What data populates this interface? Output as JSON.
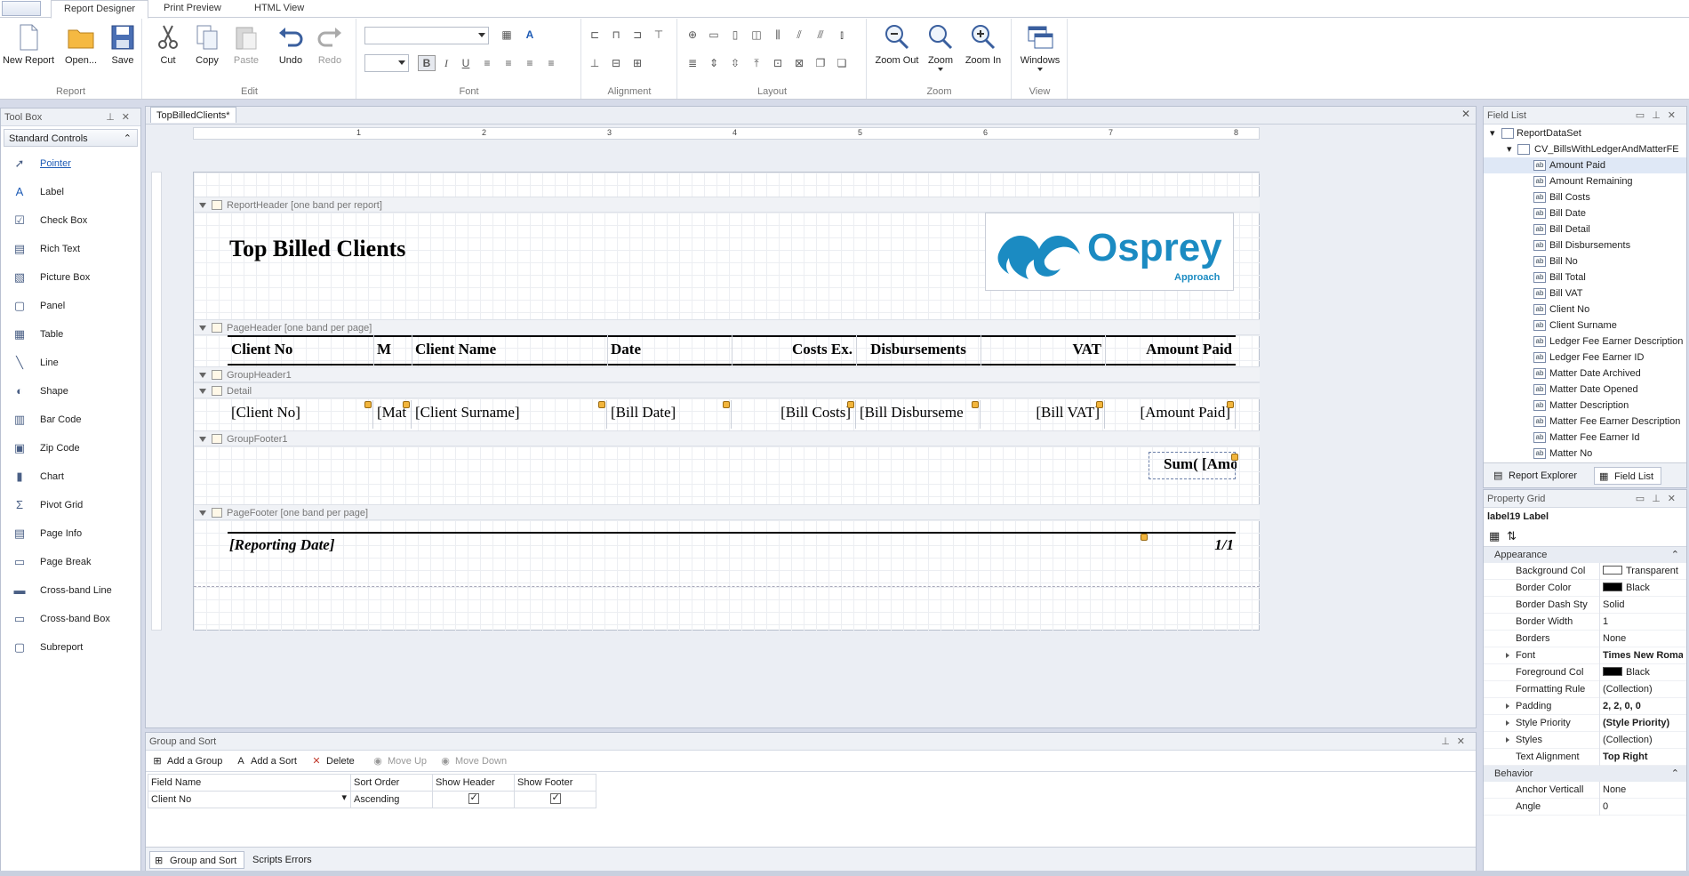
{
  "tabs": [
    "Report Designer",
    "Print Preview",
    "HTML View"
  ],
  "ribbon": {
    "report": {
      "label": "Report",
      "new": "New Report",
      "open": "Open...",
      "save": "Save"
    },
    "edit": {
      "label": "Edit",
      "cut": "Cut",
      "copy": "Copy",
      "paste": "Paste",
      "undo": "Undo",
      "redo": "Redo"
    },
    "font": {
      "label": "Font"
    },
    "alignment": {
      "label": "Alignment"
    },
    "layout": {
      "label": "Layout"
    },
    "zoom": {
      "label": "Zoom",
      "zoom_out": "Zoom Out",
      "zoom": "Zoom",
      "zoom_in": "Zoom In"
    },
    "view": {
      "label": "View",
      "windows": "Windows"
    }
  },
  "toolbox": {
    "title": "Tool Box",
    "category": "Standard Controls",
    "items": [
      "Pointer",
      "Label",
      "Check Box",
      "Rich Text",
      "Picture Box",
      "Panel",
      "Table",
      "Line",
      "Shape",
      "Bar Code",
      "Zip Code",
      "Chart",
      "Pivot Grid",
      "Page Info",
      "Page Break",
      "Cross-band Line",
      "Cross-band Box",
      "Subreport"
    ],
    "icons": [
      "pointer-icon",
      "label-icon",
      "checkbox-icon",
      "richtext-icon",
      "picturebox-icon",
      "panel-icon",
      "table-icon",
      "line-icon",
      "shape-icon",
      "barcode-icon",
      "zipcode-icon",
      "chart-icon",
      "pivotgrid-icon",
      "pageinfo-icon",
      "pagebreak-icon",
      "crossband-line-icon",
      "crossband-box-icon",
      "subreport-icon"
    ]
  },
  "document": {
    "tab": "TopBilledClients*",
    "ruler_marks": [
      "1",
      "2",
      "3",
      "4",
      "5",
      "6",
      "7",
      "8"
    ],
    "bands": {
      "report_header": "ReportHeader [one band per report]",
      "page_header": "PageHeader [one band per page]",
      "group_header": "GroupHeader1",
      "detail": "Detail",
      "group_footer": "GroupFooter1",
      "page_footer": "PageFooter [one band per page]"
    },
    "title": "Top Billed Clients",
    "logo": {
      "word": "Osprey",
      "tagline": "Approach",
      "color": "#1b8bc2"
    },
    "headers": [
      "Client No",
      "M",
      "Client Name",
      "Date",
      "Costs Ex.",
      "Disbursements",
      "VAT",
      "Amount Paid"
    ],
    "detail": [
      "[Client No]",
      "[Mat",
      "[Client Surname]",
      "[Bill Date]",
      "[Bill Costs]",
      "[Bill Disburseme",
      "[Bill VAT]",
      "[Amount Paid]"
    ],
    "group_footer_sum": "Sum( [Amount",
    "page_footer": {
      "date": "[Reporting Date]",
      "page": "1/1"
    }
  },
  "field_list": {
    "title": "Field List",
    "root": "ReportDataSet",
    "table": "CV_BillsWithLedgerAndMatterFE",
    "fields": [
      "Amount Paid",
      "Amount Remaining",
      "Bill Costs",
      "Bill Date",
      "Bill Detail",
      "Bill Disbursements",
      "Bill No",
      "Bill Total",
      "Bill VAT",
      "Client No",
      "Client Surname",
      "Ledger Fee Earner Description",
      "Ledger Fee Earner ID",
      "Matter Date Archived",
      "Matter Date Opened",
      "Matter Description",
      "Matter Fee Earner Description",
      "Matter Fee Earner Id",
      "Matter No"
    ],
    "tabs": [
      "Report Explorer",
      "Field List"
    ]
  },
  "property_grid": {
    "title": "Property Grid",
    "selected": "label19  Label",
    "categories": [
      "Appearance",
      "Behavior"
    ],
    "rows": [
      {
        "name": "Background Col",
        "value": "Transparent",
        "swatch": "#ffffff"
      },
      {
        "name": "Border Color",
        "value": "Black",
        "swatch": "#000000"
      },
      {
        "name": "Border Dash Sty",
        "value": "Solid"
      },
      {
        "name": "Border Width",
        "value": "1"
      },
      {
        "name": "Borders",
        "value": "None"
      },
      {
        "name": "Font",
        "value": "Times New Roma...",
        "bold": true,
        "expand": true
      },
      {
        "name": "Foreground Col",
        "value": "Black",
        "swatch": "#000000"
      },
      {
        "name": "Formatting Rule",
        "value": "(Collection)"
      },
      {
        "name": "Padding",
        "value": "2, 2, 0, 0",
        "bold": true,
        "expand": true
      },
      {
        "name": "Style Priority",
        "value": "(Style Priority)",
        "bold": true,
        "expand": true
      },
      {
        "name": "Styles",
        "value": "(Collection)",
        "expand": true
      },
      {
        "name": "Text Alignment",
        "value": "Top Right",
        "bold": true
      }
    ],
    "behavior_rows": [
      {
        "name": "Anchor Verticall",
        "value": "None"
      },
      {
        "name": "Angle",
        "value": "0"
      }
    ]
  },
  "group_sort": {
    "title": "Group and Sort",
    "buttons": [
      "Add a Group",
      "Add a Sort",
      "Delete",
      "Move Up",
      "Move Down"
    ],
    "columns": [
      "Field Name",
      "Sort Order",
      "Show Header",
      "Show Footer"
    ],
    "row": {
      "field": "Client No",
      "order": "Ascending",
      "show_header": true,
      "show_footer": true
    },
    "tabs": [
      "Group and Sort",
      "Scripts Errors"
    ]
  }
}
